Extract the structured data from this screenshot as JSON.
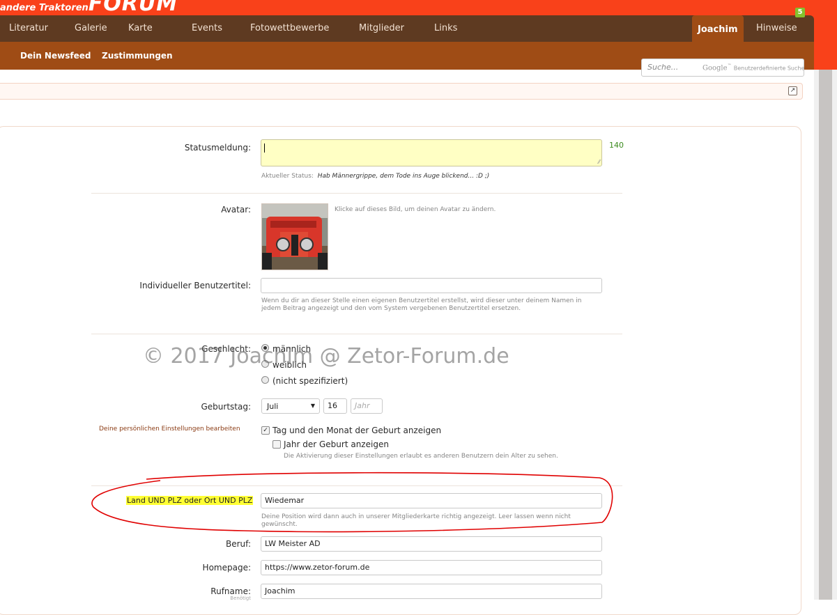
{
  "logo": {
    "small": "andere Traktoren",
    "big": "FORUM"
  },
  "nav": {
    "items": [
      "Literatur",
      "Galerie",
      "Karte",
      "Events",
      "Fotowettbewerbe",
      "Mitglieder",
      "Links"
    ],
    "user": "Joachim",
    "alerts": "Hinweise",
    "alerts_badge": "5"
  },
  "subnav": {
    "items": [
      "Dein Newsfeed",
      "Zustimmungen"
    ]
  },
  "search": {
    "placeholder": "Suche...",
    "google": "Google",
    "custom": "Benutzerdefinierte Suche"
  },
  "colors": {
    "brand_red": "#f9411a",
    "nav_dark": "#5e3a21",
    "nav_active": "#9f4c15",
    "highlight": "#ffff33",
    "annotation": "#e00000",
    "counter": "#3a8a1c"
  },
  "form": {
    "status": {
      "label": "Statusmeldung:",
      "counter": "140",
      "current_label": "Aktueller Status:",
      "current_text": "Hab Männergrippe, dem Tode ins Auge blickend... :D ;)"
    },
    "avatar": {
      "label": "Avatar:",
      "hint": "Klicke auf dieses Bild, um deinen Avatar zu ändern."
    },
    "title": {
      "label": "Individueller Benutzertitel:",
      "value": "",
      "hint": "Wenn du dir an dieser Stelle einen eigenen Benutzertitel erstellst, wird dieser unter deinem Namen in jedem Beitrag angezeigt und den vom System vergebenen Benutzertitel ersetzen."
    },
    "gender": {
      "label": "Geschlecht:",
      "options": [
        "männlich",
        "weiblich",
        "(nicht spezifiziert)"
      ],
      "selected": "männlich"
    },
    "birthday": {
      "label": "Geburtstag:",
      "month": "Juli",
      "day": "16",
      "year_placeholder": "Jahr"
    },
    "privacy": {
      "link": "Deine persönlichen Einstellungen bearbeiten",
      "show_day_month": "Tag und den Monat der Geburt anzeigen",
      "show_day_month_checked": true,
      "show_year": "Jahr der Geburt anzeigen",
      "show_year_checked": false,
      "hint": "Die Aktivierung dieser Einstellungen erlaubt es anderen Benutzern dein Alter zu sehen."
    },
    "location": {
      "label": "Land UND PLZ oder Ort UND PLZ",
      "value": "Wiedemar",
      "hint": "Deine Position wird dann auch in unserer Mitgliederkarte richtig angezeigt. Leer lassen wenn nicht gewünscht."
    },
    "occupation": {
      "label": "Beruf:",
      "value": "LW Meister AD"
    },
    "homepage": {
      "label": "Homepage:",
      "value": "https://www.zetor-forum.de"
    },
    "nickname": {
      "label": "Rufname:",
      "value": "Joachim",
      "sub": "Benötigt"
    }
  },
  "watermark": "© 2017 Joachim @ Zetor-Forum.de"
}
